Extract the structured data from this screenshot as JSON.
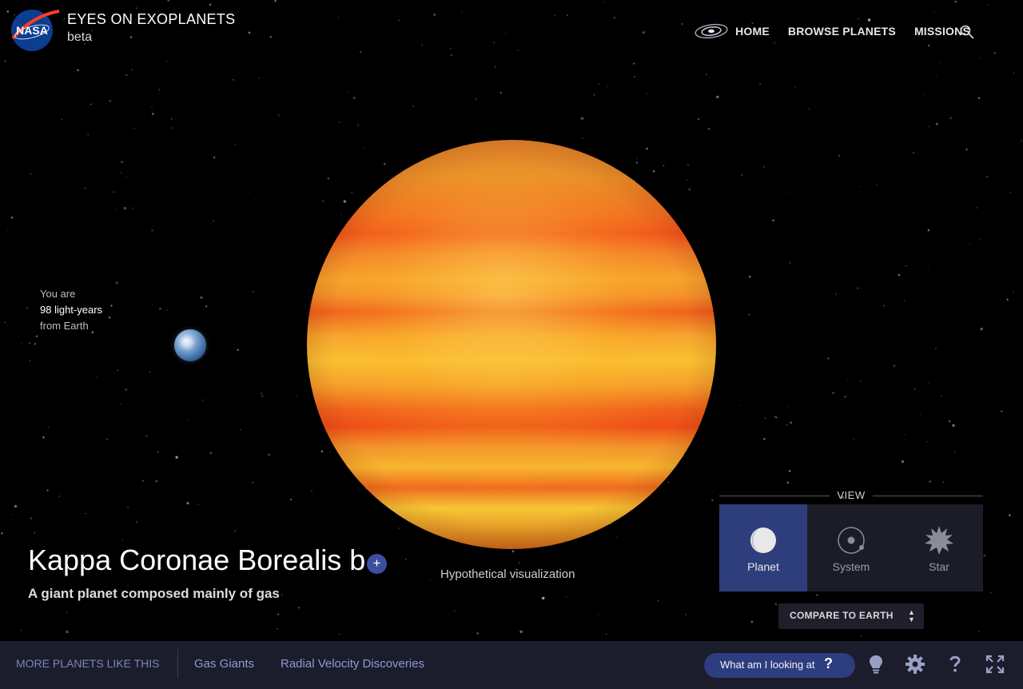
{
  "header": {
    "logo_text": "NASA",
    "title": "EYES ON EXOPLANETS",
    "subtitle": "beta",
    "nav": [
      "HOME",
      "BROWSE PLANETS",
      "MISSIONS"
    ],
    "search_icon": "search-icon"
  },
  "distance": {
    "prefix": "You are",
    "value": "98 light-years",
    "suffix": "from Earth"
  },
  "planet": {
    "name": "Kappa Coronae Borealis b",
    "add_label": "+",
    "description": "A giant planet composed mainly of gas",
    "visual_note": "Hypothetical visualization"
  },
  "view": {
    "title": "VIEW",
    "options": [
      {
        "label": "Planet",
        "icon": "planet-icon",
        "active": true
      },
      {
        "label": "System",
        "icon": "system-icon",
        "active": false
      },
      {
        "label": "Star",
        "icon": "star-icon",
        "active": false
      }
    ],
    "compare_label": "COMPARE TO EARTH",
    "compare_arrows": "▲▼"
  },
  "bottom": {
    "more_label": "MORE PLANETS LIKE THIS",
    "categories": [
      "Gas Giants",
      "Radial Velocity Discoveries"
    ],
    "what_label": "What am I looking at",
    "what_q": "?",
    "tools": [
      "lightbulb-icon",
      "gear-icon",
      "help-icon",
      "fullscreen-icon"
    ]
  },
  "colors": {
    "accent": "#2e3d80",
    "bar": "#1b1d2c",
    "link": "#8f9ad0"
  }
}
